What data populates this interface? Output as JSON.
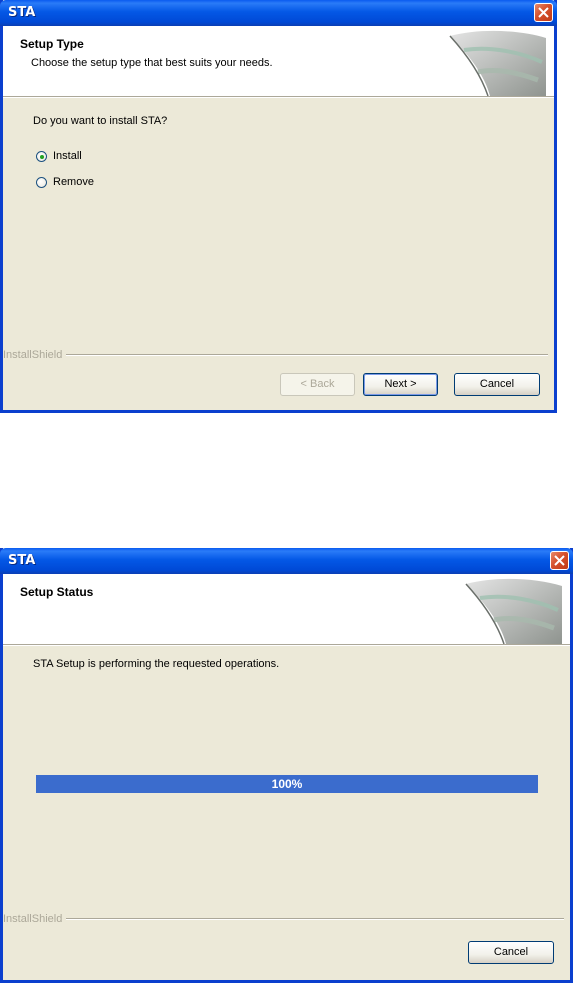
{
  "dialog1": {
    "title": "STA",
    "header_title": "Setup Type",
    "header_subtitle": "Choose the setup type that best suits your needs.",
    "question": "Do you want to install STA?",
    "options": [
      {
        "label": "Install",
        "selected": true
      },
      {
        "label": "Remove",
        "selected": false
      }
    ],
    "brand": "InstallShield",
    "buttons": {
      "back": "< Back",
      "next": "Next >",
      "cancel": "Cancel"
    }
  },
  "dialog2": {
    "title": "STA",
    "header_title": "Setup Status",
    "status_text": "STA Setup is performing the requested operations.",
    "progress": {
      "label": "100%",
      "fraction": 1.0
    },
    "brand": "InstallShield",
    "buttons": {
      "cancel": "Cancel"
    }
  },
  "colors": {
    "titlebar_blue": "#0458e6",
    "dialog_bg": "#ece9d8",
    "progress_fill": "#3b6ccd",
    "close_red": "#d5502c"
  },
  "icons": [
    "close-icon",
    "installshield-logo-icon",
    "radio-icon"
  ]
}
